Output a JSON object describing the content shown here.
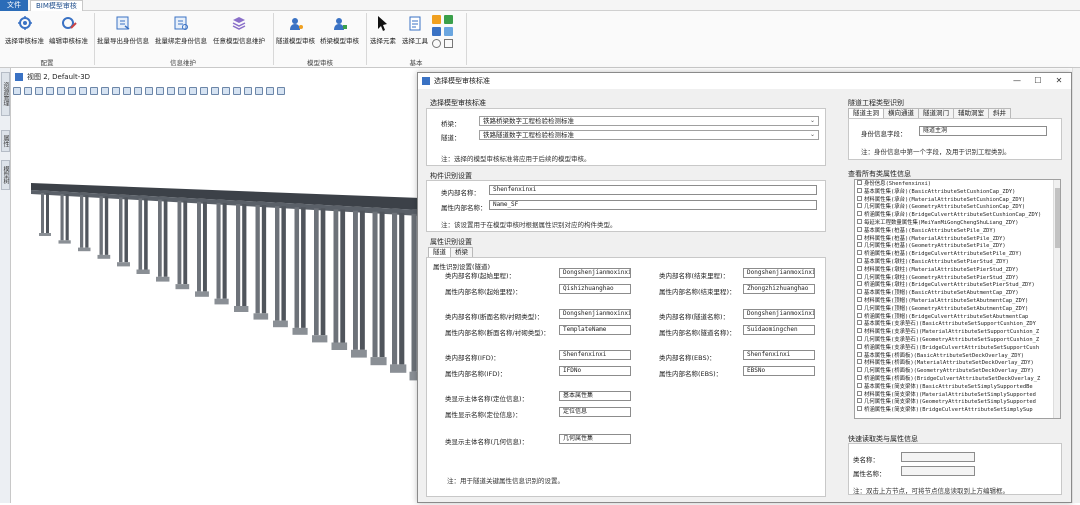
{
  "menubar": {
    "file": "文件",
    "tab": "BIM模型审核"
  },
  "ribbon": {
    "groups": [
      "配置",
      "信息维护",
      "模型审核",
      "基本"
    ],
    "buttons": [
      {
        "label": "选择审核标准",
        "icon": "gear-check-icon"
      },
      {
        "label": "编辑审核标准",
        "icon": "gear-edit-icon"
      },
      {
        "label": "批量导出身份信息",
        "icon": "export-id-icon"
      },
      {
        "label": "批量绑定身份信息",
        "icon": "bind-id-icon"
      },
      {
        "label": "任意模型信息维护",
        "icon": "layers-icon"
      },
      {
        "label": "隧道模型审核",
        "icon": "tunnel-check-icon"
      },
      {
        "label": "桥梁模型审核",
        "icon": "bridge-check-icon"
      },
      {
        "label": "选择元素",
        "icon": "cursor-icon"
      },
      {
        "label": "选择工具",
        "icon": "select-tool-icon"
      }
    ]
  },
  "left_rail": {
    "tabs": [
      "资源管理",
      "属性",
      "模型树"
    ]
  },
  "viewport": {
    "title": "视图 2, Default-3D"
  },
  "dialog": {
    "title": "选择模型审核标准",
    "standard": {
      "section": "选择模型审核标准",
      "bridge_label": "桥梁：",
      "bridge_value": "铁路桥梁数字工程检验检测标准",
      "tunnel_label": "隧道：",
      "tunnel_value": "铁路隧道数字工程检验检测标准",
      "note": "注：选择的模型审核标准将应用于后续的模型审核。"
    },
    "component": {
      "section": "构件识别设置",
      "class_label": "类内部名称：",
      "class_value": "Shenfenxinxi",
      "attr_label": "属性内部名称：",
      "attr_value": "Name_SF",
      "note": "注：该设置用于在模型审核时根据属性识别对应的构件类型。"
    },
    "attr_id": {
      "section": "属性识别设置",
      "tabs": [
        "隧道",
        "桥梁"
      ],
      "subsection": "属性识别设置(隧道)",
      "left": [
        {
          "label": "类内部名称(起始里程)：",
          "value": "Dongshenjianmoxinxi"
        },
        {
          "label": "属性内部名称(起始里程)：",
          "value": "Qishizhuanghao"
        },
        {
          "label": "类内部名称(断面名称/衬砌类型)：",
          "value": "Dongshenjianmoxinxi"
        },
        {
          "label": "属性内部名称(断面名称/衬砌类型)：",
          "value": "TemplateName"
        },
        {
          "label": "类内部名称(IFD)：",
          "value": "Shenfenxinxi"
        },
        {
          "label": "属性内部名称(IFD)：",
          "value": "IFDNo"
        },
        {
          "label": "类显示主体名称(定位信息)：",
          "value": "基本属性集"
        },
        {
          "label": "属性显示名称(定位信息)：",
          "value": "定位信息"
        },
        {
          "label": "类显示主体名称(几何信息)：",
          "value": "几何属性集"
        }
      ],
      "right": [
        {
          "label": "类内部名称(结束里程)：",
          "value": "Dongshenjianmoxinxi"
        },
        {
          "label": "属性内部名称(结束里程)：",
          "value": "Zhongzhizhuanghao"
        },
        {
          "label": "类内部名称(隧道名称)：",
          "value": "Dongshenjianmoxinxi"
        },
        {
          "label": "属性内部名称(隧道名称)：",
          "value": "Suidaomingchen"
        },
        {
          "label": "类内部名称(EBS)：",
          "value": "Shenfenxinxi"
        },
        {
          "label": "属性内部名称(EBS)：",
          "value": "EBSNo"
        }
      ],
      "note": "注：用于隧道关键属性信息识别的设置。"
    },
    "tunnel_type": {
      "section": "隧道工程类型识别",
      "tabs": [
        "隧道主洞",
        "横向通道",
        "隧道洞门",
        "辅助洞室",
        "斜井"
      ],
      "id_label": "身份信息字段：",
      "id_value": "隧道主洞",
      "note": "注：身份信息中第一个字段，及用于识别工程类别。"
    },
    "all_classes": {
      "section": "查看所有类属性信息",
      "rows": [
        "身份信息(Shenfenxinxi)",
        "基本属性集(承台)(BasicAttributeSetCushionCap_ZDY)",
        "材料属性集(承台)(MaterialAttributeSetCushionCap_ZDY)",
        "几何属性集(承台)(GeometryAttributeSetCushionCap_ZDY)",
        "桥涵属性集(承台)(BridgeCulvertAttributeSetCushionCap_ZDY)",
        "每延米工程数量属性集(MeiYanMiGongChengShuLiang_ZDY)",
        "基本属性集(桩基)(BasicAttributeSetPile_ZDY)",
        "材料属性集(桩基)(MaterialAttributeSetPile_ZDY)",
        "几何属性集(桩基)(GeometryAttributeSetPile_ZDY)",
        "桥涵属性集(桩基)(BridgeCulvertAttributeSetPile_ZDY)",
        "基本属性集(墩柱)(BasicAttributeSetPierStud_ZDY)",
        "材料属性集(墩柱)(MaterialAttributeSetPierStud_ZDY)",
        "几何属性集(墩柱)(GeometryAttributeSetPierStud_ZDY)",
        "桥涵属性集(墩柱)(BridgeCulvertAttributeSetPierStud_ZDY)",
        "基本属性集(顶帽)(BasicAttributeSetAbutmentCap_ZDY)",
        "材料属性集(顶帽)(MaterialAttributeSetAbutmentCap_ZDY)",
        "几何属性集(顶帽)(GeometryAttributeSetAbutmentCap_ZDY)",
        "桥涵属性集(顶帽)(BridgeCulvertAttributeSetAbutmentCap",
        "基本属性集(支承垫石)(BasicAttributeSetSupportCushion_ZDY",
        "材料属性集(支承垫石)(MaterialAttributeSetSupportCushion_Z",
        "几何属性集(支承垫石)(GeometryAttributeSetSupportCushion_Z",
        "桥涵属性集(支承垫石)(BridgeCulvertAttributeSetSupportCush",
        "基本属性集(桥面板)(BasicAttributeSetDeckOverlay_ZDY)",
        "材料属性集(桥面板)(MaterialAttributeSetDeckOverlay_ZDY)",
        "几何属性集(桥面板)(GeometryAttributeSetDeckOverlay_ZDY)",
        "桥涵属性集(桥面板)(BridgeCulvertAttributeSetDeckOverlay_Z",
        "基本属性集(简支梁体)(BasicAttributeSetSimplySupportedBe",
        "材料属性集(简支梁体)(MaterialAttributeSetSimplySupported",
        "几何属性集(简支梁体)(GeometryAttributeSetSimplySupported",
        "桥涵属性集(简支梁体)(BridgeCulvertAttributeSetSimplySup"
      ]
    },
    "quick": {
      "section": "快速读取类与属性信息",
      "class_label": "类名称：",
      "attr_label": "属性名称：",
      "note": "注：双击上方节点，可将节点信息读取到上方编辑框。"
    }
  },
  "colors": {
    "accent": "#2b6cb8",
    "ribbon_icon": "#3a72c4"
  }
}
